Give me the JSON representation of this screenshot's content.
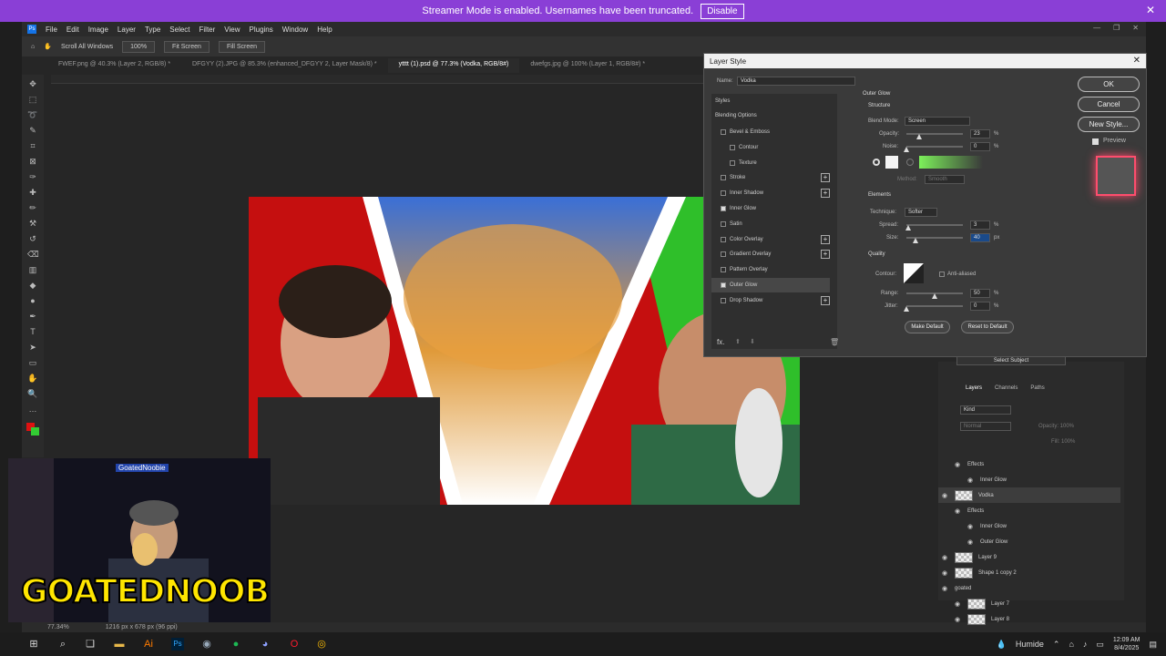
{
  "banner": {
    "message": "Streamer Mode is enabled. Usernames have been truncated.",
    "disable_label": "Disable"
  },
  "menu": [
    "File",
    "Edit",
    "Image",
    "Layer",
    "Type",
    "Select",
    "Filter",
    "View",
    "Plugins",
    "Window",
    "Help"
  ],
  "options": {
    "scroll_all": "Scroll All Windows",
    "zoom": "100%",
    "fit": "Fit Screen",
    "fill": "Fill Screen"
  },
  "tabs": [
    "FWEF.png @ 40.3% (Layer 2, RGB/8) *",
    "DFGYY (2).JPG @ 85.3% (enhanced_DFGYY 2, Layer Mask/8) *",
    "ytttt (1).psd @ 77.3% (Vodka, RGB/8#)",
    "dwefgs.jpg @ 100% (Layer 1, RGB/8#) *"
  ],
  "status": {
    "zoom": "77.34%",
    "doc": "1216 px x 678 px (96 ppi)"
  },
  "dialog": {
    "title": "Layer Style",
    "name_label": "Name:",
    "name_value": "Vodka",
    "styles_header": "Styles",
    "blending": "Blending Options",
    "styles": [
      {
        "label": "Bevel & Emboss",
        "on": false,
        "indent": false,
        "plus": false
      },
      {
        "label": "Contour",
        "on": false,
        "indent": true,
        "plus": false
      },
      {
        "label": "Texture",
        "on": false,
        "indent": true,
        "plus": false
      },
      {
        "label": "Stroke",
        "on": false,
        "indent": false,
        "plus": true
      },
      {
        "label": "Inner Shadow",
        "on": false,
        "indent": false,
        "plus": true
      },
      {
        "label": "Inner Glow",
        "on": true,
        "indent": false,
        "plus": false
      },
      {
        "label": "Satin",
        "on": false,
        "indent": false,
        "plus": false
      },
      {
        "label": "Color Overlay",
        "on": false,
        "indent": false,
        "plus": true
      },
      {
        "label": "Gradient Overlay",
        "on": false,
        "indent": false,
        "plus": true
      },
      {
        "label": "Pattern Overlay",
        "on": false,
        "indent": false,
        "plus": false
      },
      {
        "label": "Outer Glow",
        "on": true,
        "indent": false,
        "plus": false
      },
      {
        "label": "Drop Shadow",
        "on": false,
        "indent": false,
        "plus": true
      }
    ],
    "fx": "fx.",
    "section": "Outer Glow",
    "structure": "Structure",
    "blend_mode_label": "Blend Mode:",
    "blend_mode": "Screen",
    "opacity_label": "Opacity:",
    "opacity": "23",
    "noise_label": "Noise:",
    "noise": "0",
    "method_label": "Method:",
    "method": "Smooth",
    "elements": "Elements",
    "technique_label": "Technique:",
    "technique": "Softer",
    "spread_label": "Spread:",
    "spread": "3",
    "size_label": "Size:",
    "size": "40",
    "quality": "Quality",
    "contour_label": "Contour:",
    "antialiased": "Anti-aliased",
    "range_label": "Range:",
    "range": "50",
    "jitter_label": "Jitter:",
    "jitter": "0",
    "pct": "%",
    "px": "px",
    "make_default": "Make Default",
    "reset_default": "Reset to Default",
    "ok": "OK",
    "cancel": "Cancel",
    "new_style": "New Style...",
    "preview": "Preview",
    "glow_color": "#7cf05a"
  },
  "layers_panel": {
    "tabs": [
      "Layers",
      "Channels",
      "Paths"
    ],
    "select_subject": "Select Subject",
    "kind": "Kind",
    "mode": "Normal",
    "opacity": "Opacity: 100%",
    "fill": "Fill: 100%",
    "rows": [
      {
        "label": "Effects",
        "indent": 1,
        "thumb": false
      },
      {
        "label": "Inner Glow",
        "indent": 2,
        "thumb": false
      },
      {
        "label": "Vodka",
        "indent": 0,
        "thumb": true
      },
      {
        "label": "Effects",
        "indent": 1,
        "thumb": false
      },
      {
        "label": "Inner Glow",
        "indent": 2,
        "thumb": false
      },
      {
        "label": "Outer Glow",
        "indent": 2,
        "thumb": false
      },
      {
        "label": "Layer 9",
        "indent": 0,
        "thumb": true
      },
      {
        "label": "Shape 1 copy 2",
        "indent": 0,
        "thumb": true
      },
      {
        "label": "goated",
        "indent": 0,
        "thumb": false
      },
      {
        "label": "Layer 7",
        "indent": 1,
        "thumb": true
      },
      {
        "label": "Layer 8",
        "indent": 1,
        "thumb": true
      }
    ]
  },
  "webcam": {
    "handle": "GoatedNoobie",
    "logo": "GOATEDNOOBIE"
  },
  "taskbar": {
    "weather": "Humide",
    "time": "12:09 AM",
    "date": "8/4/2025"
  }
}
